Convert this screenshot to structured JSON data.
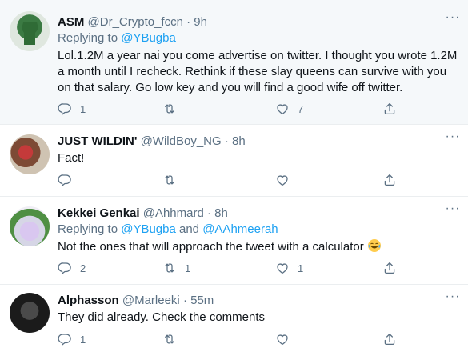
{
  "tweets": [
    {
      "name": "ASM",
      "handle": "@Dr_Crypto_fccn",
      "dot": "·",
      "time": "9h",
      "replying_prefix": "Replying to ",
      "replying_to": "@YBugba",
      "replying_and": "",
      "replying_to_2": "",
      "text": "Lol.1.2M a year nai you come advertise on twitter. I thought you wrote 1.2M a month until I recheck. Rethink if these slay queens can survive with you on that salary. Go low key and you will find a good wife off twitter.",
      "reply_count": "1",
      "retweet_count": "",
      "like_count": "7"
    },
    {
      "name": "JUST WILDIN'",
      "handle": "@WildBoy_NG",
      "dot": "·",
      "time": "8h",
      "text": "Fact!",
      "reply_count": "",
      "retweet_count": "",
      "like_count": ""
    },
    {
      "name": "Kekkei Genkai",
      "handle": "@Ahhmard",
      "dot": "·",
      "time": "8h",
      "replying_prefix": "Replying to ",
      "replying_to": "@YBugba",
      "replying_and": " and ",
      "replying_to_2": "@AAhmeerah",
      "text": "Not the ones that will approach the tweet with a calculator ",
      "reply_count": "2",
      "retweet_count": "1",
      "like_count": "1"
    },
    {
      "name": "Alphasson",
      "handle": "@Marleeki",
      "dot": "·",
      "time": "55m",
      "text": "They did already. Check the comments",
      "reply_count": "1",
      "retweet_count": "",
      "like_count": ""
    }
  ],
  "icons": {
    "more": "more-horizontal-icon",
    "reply": "reply-icon",
    "retweet": "retweet-icon",
    "like": "heart-icon",
    "share": "share-icon",
    "emoji": "laughing-tears-emoji"
  },
  "colors": {
    "link": "#1da1f2",
    "secondary": "#5b7083",
    "highlight_bg": "#f5f8fa",
    "divider": "#ebeef0"
  }
}
